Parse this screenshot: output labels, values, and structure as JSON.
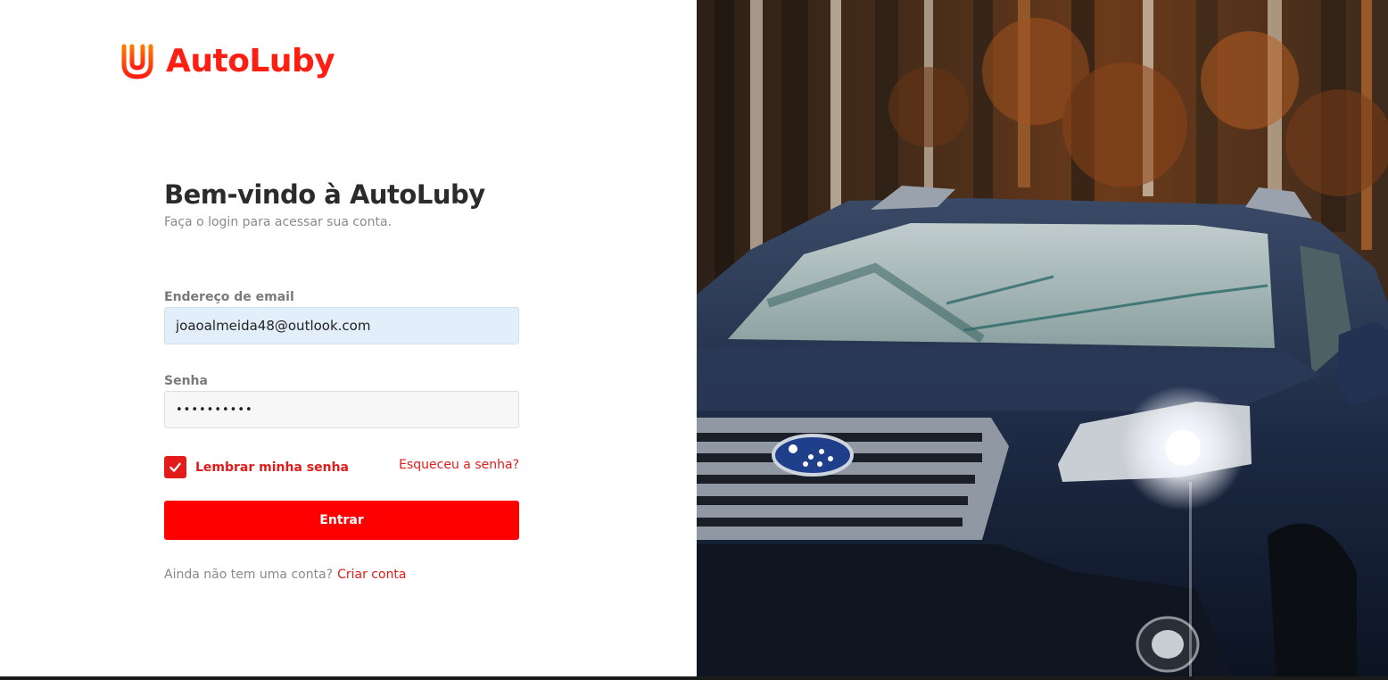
{
  "brand": {
    "name": "AutoLuby",
    "color": "#ff1e12"
  },
  "login": {
    "title": "Bem-vindo à AutoLuby",
    "subtitle": "Faça o login para acessar sua conta.",
    "email_label": "Endereço de email",
    "email_value": "joaoalmeida48@outlook.com",
    "password_label": "Senha",
    "password_value": "••••••••••",
    "remember_label": "Lembrar minha senha",
    "remember_checked": true,
    "forgot_label": "Esqueceu a senha?",
    "submit_label": "Entrar",
    "signup_prompt": "Ainda não tem uma conta?",
    "signup_link": "Criar conta"
  },
  "hero_image": {
    "icon": "car-photo"
  },
  "colors": {
    "accent": "#ff0000",
    "input_filled_bg": "#e3eefb",
    "input_bg": "#f7f7f7"
  }
}
